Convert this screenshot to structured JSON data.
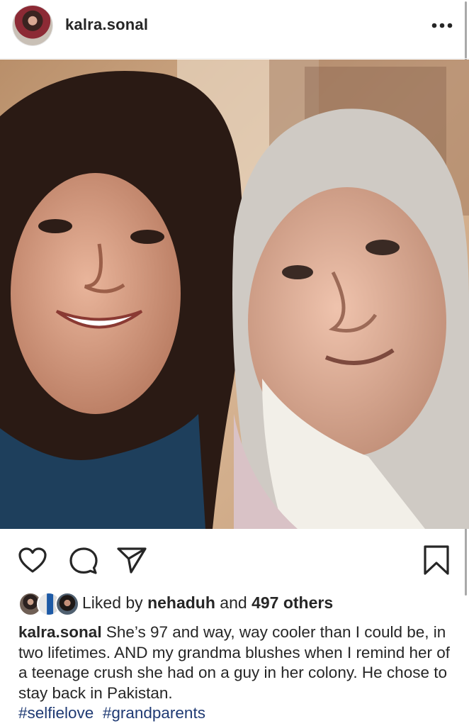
{
  "post": {
    "username": "kalra.sonal",
    "avatar_icon": "profile-photo",
    "more_icon": "more-horizontal-icon"
  },
  "actions": {
    "like_icon": "heart-icon",
    "comment_icon": "comment-icon",
    "share_icon": "paper-plane-icon",
    "save_icon": "bookmark-icon"
  },
  "likes": {
    "prefix": "Liked by",
    "user": "nehaduh",
    "middle": "and",
    "others": "497 others"
  },
  "caption": {
    "username": "kalra.sonal",
    "text": "She’s 97 and way, way cooler than I could be, in two lifetimes. AND my grandma blushes when I remind her of a teenage crush she had on a guy in her colony. He chose to stay back in Pakistan.",
    "hashtags": [
      "#selfielove",
      "#grandparents"
    ]
  },
  "colors": {
    "text": "#262626",
    "hashtag": "#1f3a73"
  }
}
